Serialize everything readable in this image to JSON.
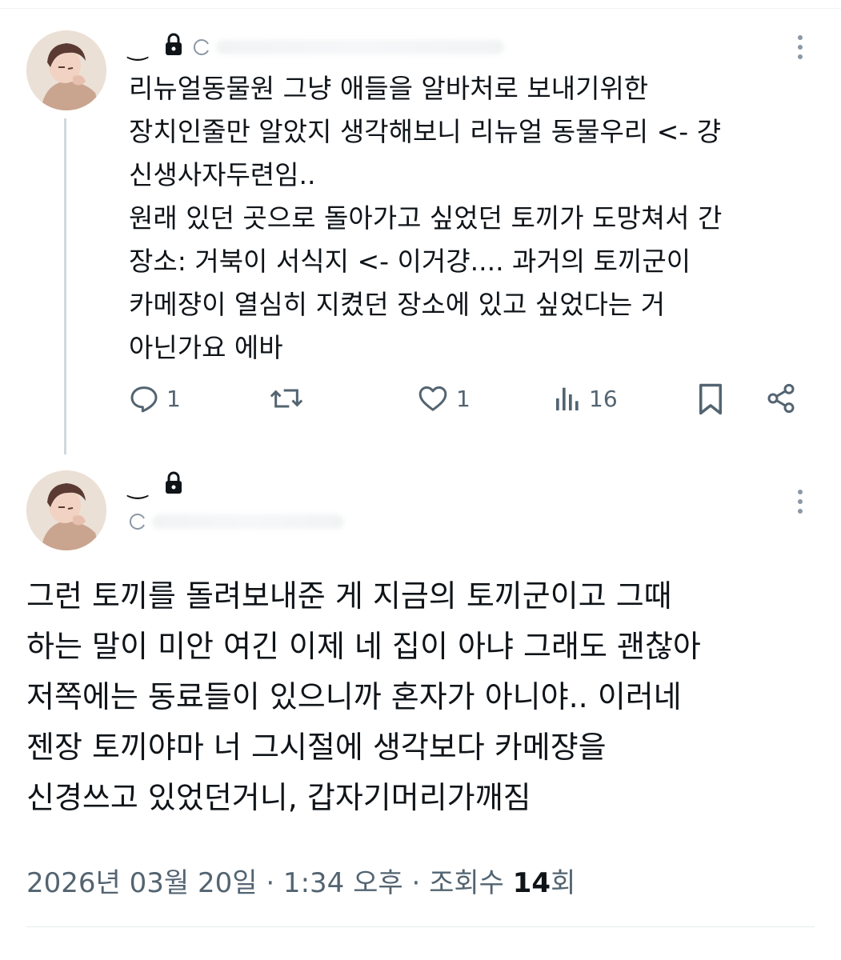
{
  "thread_reply": {
    "name": "‿",
    "text": "리뉴얼동물원 그냥 애들을 알바처로 보내기위한\n장치인줄만 알았지 생각해보니 리뉴얼 동물우리 <- 걍\n신생사자두련임..\n원래 있던 곳으로 돌아가고 싶었던 토끼가 도망쳐서 간\n장소: 거북이 서식지 <- 이거걍.... 과거의 토끼군이\n카메쟝이 열심히 지켰던 장소에 있고 싶었다는 거\n아닌가요 에바",
    "reply_count": "1",
    "like_count": "1",
    "view_count": "16"
  },
  "main_tweet": {
    "name": "‿",
    "text": "그런 토끼를 돌려보내준 게 지금의 토끼군이고 그때\n하는 말이 미안 여긴 이제 네 집이 아냐 그래도 괜찮아\n저쪽에는 동료들이 있으니까 혼자가 아니야.. 이러네\n젠장 토끼야마 너 그시절에 생각보다 카메쟝을\n신경쓰고 있었던거니, 갑자기머리가깨짐",
    "date": "2026년 03월 20일 · 1:34 오후 · 조회수 ",
    "views": "14",
    "views_suffix": "회"
  },
  "icons": [
    "lock-icon",
    "more-icon",
    "reply-icon",
    "retweet-icon",
    "like-icon",
    "views-icon",
    "bookmark-icon",
    "share-icon"
  ],
  "colors": {
    "text": "#0f1419",
    "secondary": "#536471",
    "thread_line": "#cfd9de"
  }
}
